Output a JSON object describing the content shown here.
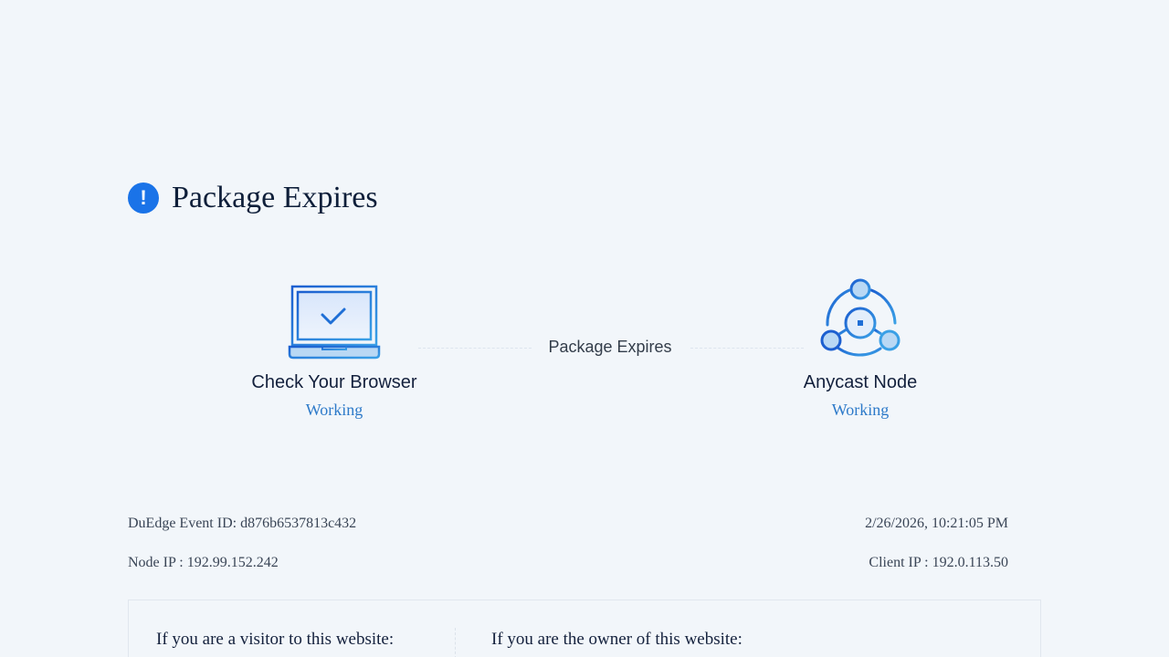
{
  "header": {
    "title": "Package Expires",
    "icon": "exclamation-icon",
    "accent_color": "#1a73e8"
  },
  "status_flow": {
    "middle_label": "Package Expires",
    "nodes": [
      {
        "icon": "laptop-check-icon",
        "name": "Check Your Browser",
        "status": "Working"
      },
      {
        "icon": "network-node-icon",
        "name": "Anycast Node",
        "status": "Working"
      }
    ],
    "status_color": "#2d7ac9"
  },
  "info": {
    "event_id": "DuEdge Event ID: d876b6537813c432",
    "timestamp": "2/26/2026, 10:21:05 PM",
    "node_ip": "Node IP : 192.99.152.242",
    "client_ip": "Client IP : 192.0.113.50"
  },
  "help": {
    "visitor_heading": "If you are a visitor to this website:",
    "owner_heading": "If you are the owner of this website:"
  }
}
